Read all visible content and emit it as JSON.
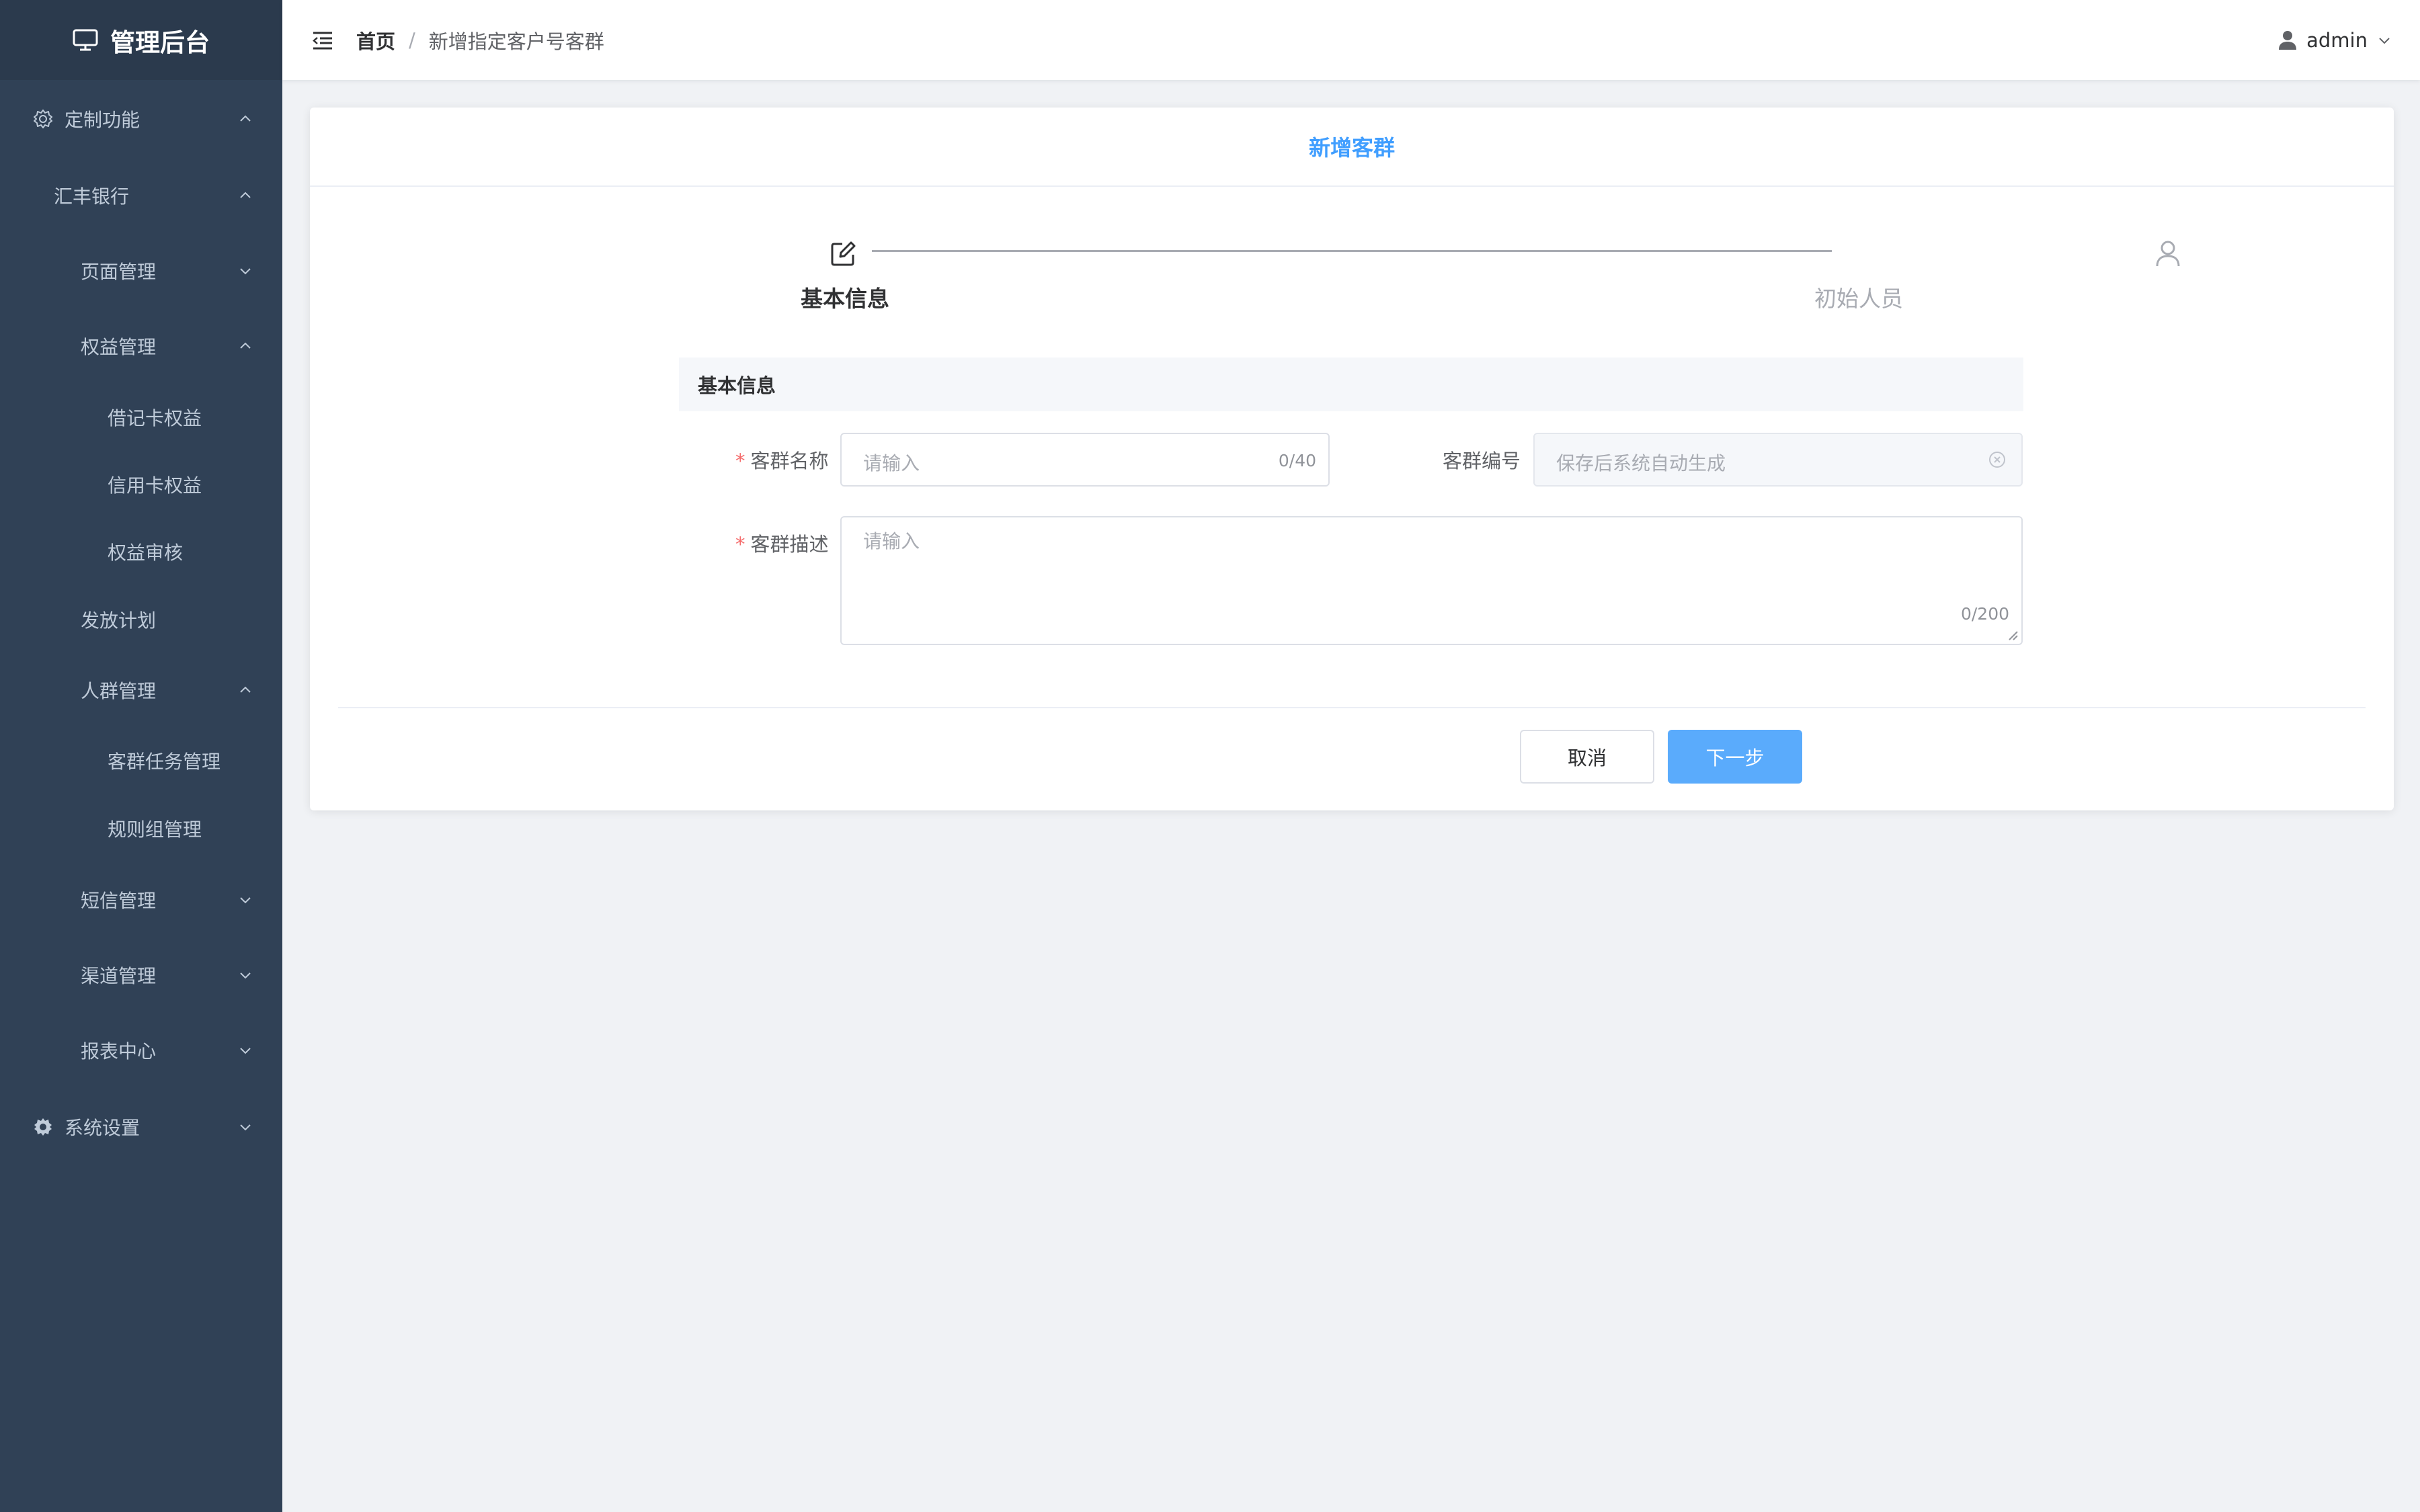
{
  "app": {
    "title": "管理后台"
  },
  "sidebar": {
    "items": [
      {
        "label": "定制功能",
        "icon": "cog-outline-icon",
        "expanded": true
      },
      {
        "label": "汇丰银行",
        "expanded": true
      },
      {
        "label": "页面管理",
        "expanded": false
      },
      {
        "label": "权益管理",
        "expanded": true
      },
      {
        "label": "借记卡权益"
      },
      {
        "label": "信用卡权益"
      },
      {
        "label": "权益审核"
      },
      {
        "label": "发放计划"
      },
      {
        "label": "人群管理",
        "expanded": true
      },
      {
        "label": "客群任务管理"
      },
      {
        "label": "规则组管理"
      },
      {
        "label": "短信管理",
        "expanded": false
      },
      {
        "label": "渠道管理",
        "expanded": false
      },
      {
        "label": "报表中心",
        "expanded": false
      },
      {
        "label": "系统设置",
        "icon": "gear-icon",
        "expanded": false
      }
    ]
  },
  "header": {
    "breadcrumb": {
      "home": "首页",
      "separator": "/",
      "current": "新增指定客户号客群"
    },
    "user": "admin"
  },
  "card": {
    "title": "新增客群"
  },
  "steps": [
    {
      "label": "基本信息",
      "icon": "edit-icon",
      "active": true
    },
    {
      "label": "初始人员",
      "icon": "user-icon",
      "active": false
    }
  ],
  "section": {
    "title": "基本信息"
  },
  "form": {
    "name": {
      "required_mark": "*",
      "label": "客群名称",
      "placeholder": "请输入",
      "counter": "0/40"
    },
    "code": {
      "label": "客群编号",
      "placeholder": "保存后系统自动生成"
    },
    "description": {
      "required_mark": "*",
      "label": "客群描述",
      "placeholder": "请输入",
      "counter": "0/200"
    }
  },
  "buttons": {
    "cancel": "取消",
    "next": "下一步"
  },
  "colors": {
    "sidebar_bg": "#304156",
    "sidebar_text": "#bfcbd9",
    "primary": "#409eff",
    "primary_button": "#5aabfc",
    "required": "#f56c6c",
    "page_bg": "#f0f2f5"
  }
}
